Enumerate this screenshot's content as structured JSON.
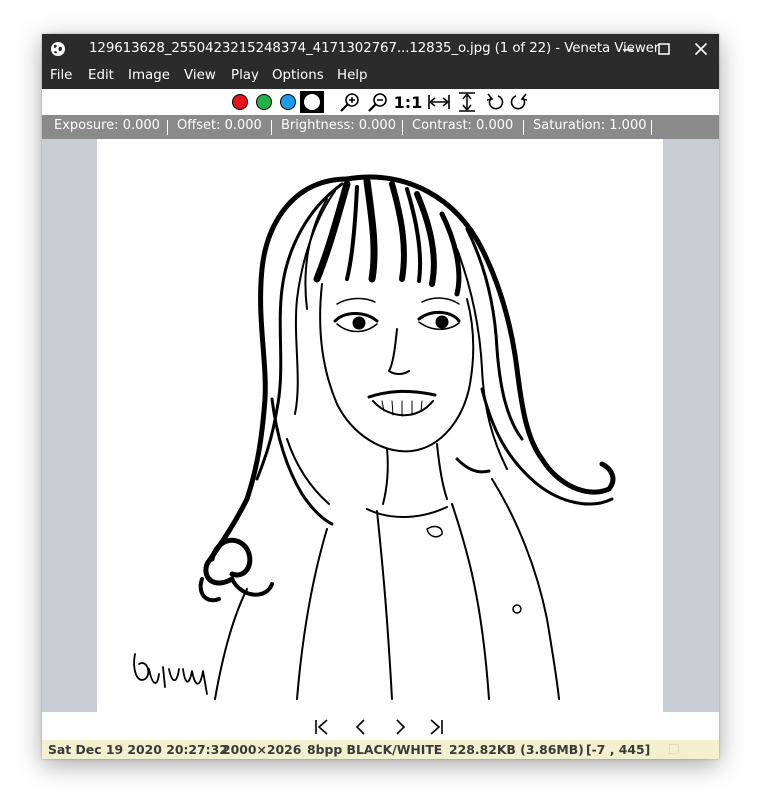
{
  "window": {
    "title": "129613628_2550423215248374_4171302767...12835_o.jpg (1 of 22) - Veneta Viewer",
    "app_icon": "globe-icon",
    "controls": [
      "minimize-icon",
      "maximize-icon",
      "close-icon"
    ]
  },
  "menu": {
    "items": [
      "File",
      "Edit",
      "Image",
      "View",
      "Play",
      "Options",
      "Help"
    ]
  },
  "toolbar": {
    "color_buttons": [
      {
        "name": "red",
        "color": "#e8141c"
      },
      {
        "name": "green",
        "color": "#22b24c"
      },
      {
        "name": "blue",
        "color": "#1e9be9"
      },
      {
        "name": "white",
        "color": "#ffffff"
      }
    ],
    "actual_size_label": "1:1",
    "icons": [
      "zoom-in-icon",
      "zoom-out-icon",
      "fit-width-icon",
      "fit-height-icon",
      "rotate-left-icon",
      "rotate-right-icon"
    ]
  },
  "adjustments": {
    "exposure": "Exposure: 0.000",
    "offset": "Offset: 0.000",
    "brightness": "Brightness: 0.000",
    "contrast": "Contrast: 0.000",
    "saturation": "Saturation: 1.000"
  },
  "image": {
    "description_icon": "portrait-drawing",
    "signature_text": "Quinny"
  },
  "navigation": {
    "icons": [
      "first-image-icon",
      "previous-image-icon",
      "next-image-icon",
      "last-image-icon"
    ]
  },
  "status": {
    "date": "Sat Dec 19 2020 20:27:32",
    "dimensions": "2000×2026",
    "format": "8bpp BLACK/WHITE",
    "size": "228.82KB (3.86MB)",
    "cursor": "[-7 , 445]"
  },
  "colors": {
    "titlebar": "#2b2b2b",
    "adjust_bar": "#8a8a8a",
    "viewport_bg": "#c8ccd3",
    "statusbar": "#f2f0cf"
  }
}
